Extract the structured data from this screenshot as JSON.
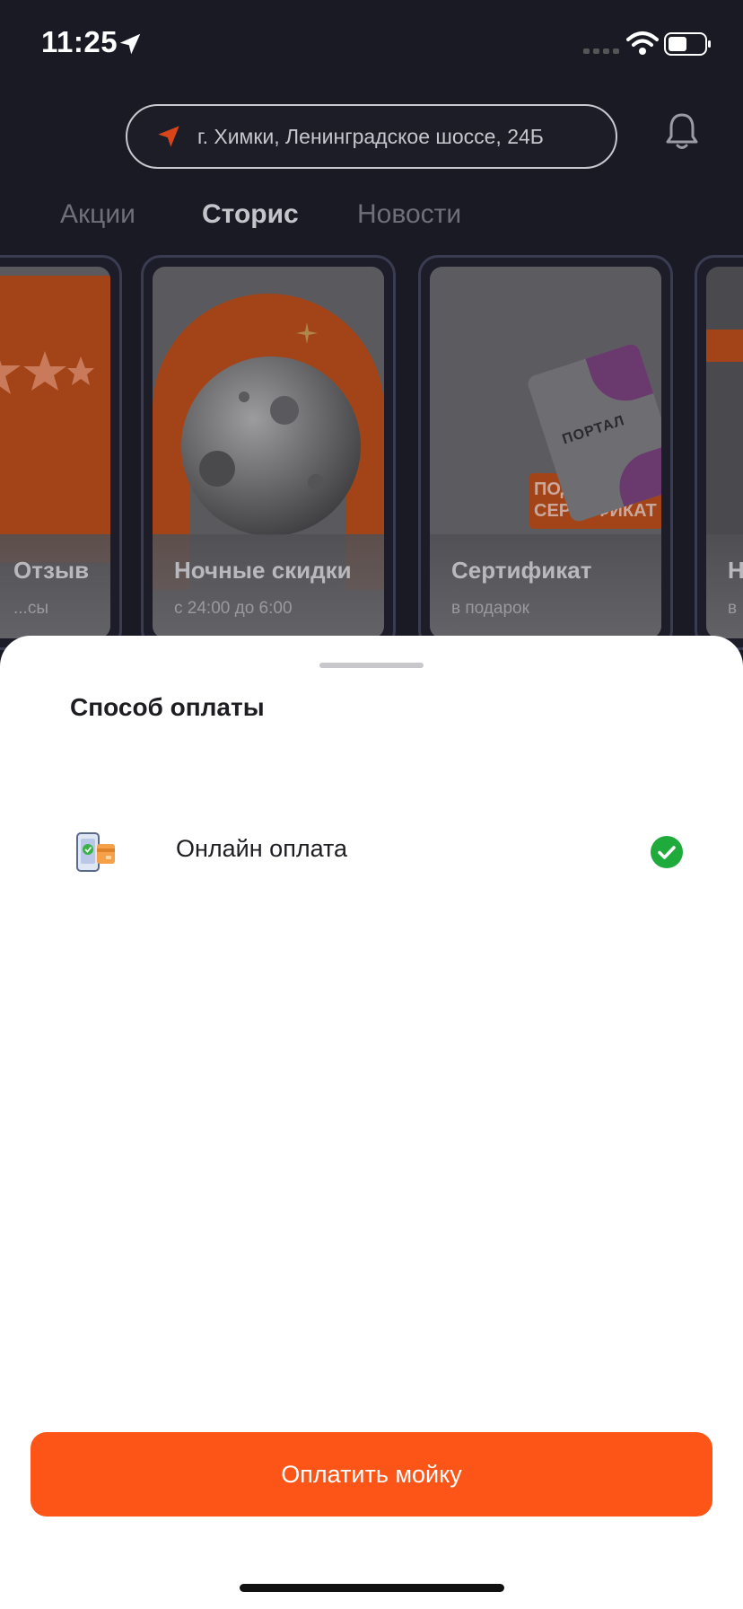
{
  "status_bar": {
    "time": "11:25",
    "icons": [
      "location-arrow-icon",
      "signal-icon",
      "wifi-icon",
      "battery-icon"
    ]
  },
  "header": {
    "address": "г. Химки, Ленинградское шоссе, 24Б",
    "pin_icon": "location-pin-icon",
    "bell_icon": "bell-icon"
  },
  "tabs": [
    {
      "label": "Акции",
      "active": false
    },
    {
      "label": "Сторис",
      "active": true
    },
    {
      "label": "Новости",
      "active": false
    }
  ],
  "stories": [
    {
      "title": "Отзыв",
      "subtitle": "...сы"
    },
    {
      "title": "Ночные скидки",
      "subtitle": "с 24:00 до 6:00"
    },
    {
      "title": "Сертификат",
      "subtitle": "в подарок",
      "card_text": "ПОРТАЛ",
      "badge": "ПОДАРИ СЕРТИФИКАТ"
    },
    {
      "title": "Н...",
      "subtitle": "в ..."
    }
  ],
  "sheet": {
    "title": "Способ оплаты",
    "option": {
      "label": "Онлайн оплата",
      "selected": true,
      "icon": "phone-payment-icon"
    },
    "button_label": "Оплатить мойку"
  },
  "colors": {
    "accent": "#fd5518",
    "background": "#191a24",
    "check": "#1faa3c"
  }
}
